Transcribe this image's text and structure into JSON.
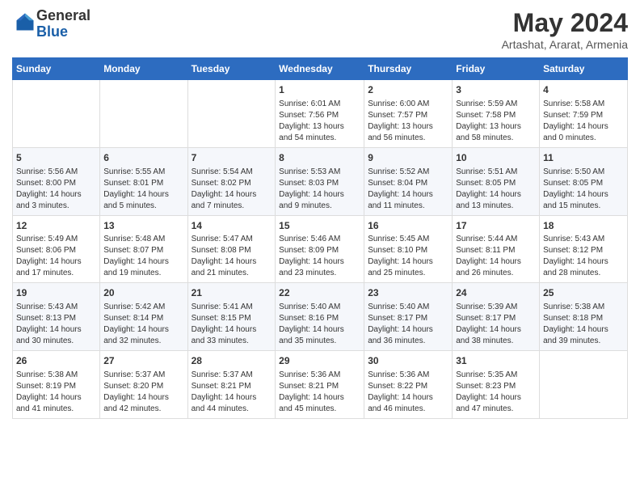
{
  "header": {
    "logo_general": "General",
    "logo_blue": "Blue",
    "month_title": "May 2024",
    "subtitle": "Artashat, Ararat, Armenia"
  },
  "days_of_week": [
    "Sunday",
    "Monday",
    "Tuesday",
    "Wednesday",
    "Thursday",
    "Friday",
    "Saturday"
  ],
  "weeks": [
    [
      {
        "num": "",
        "info": ""
      },
      {
        "num": "",
        "info": ""
      },
      {
        "num": "",
        "info": ""
      },
      {
        "num": "1",
        "info": "Sunrise: 6:01 AM\nSunset: 7:56 PM\nDaylight: 13 hours\nand 54 minutes."
      },
      {
        "num": "2",
        "info": "Sunrise: 6:00 AM\nSunset: 7:57 PM\nDaylight: 13 hours\nand 56 minutes."
      },
      {
        "num": "3",
        "info": "Sunrise: 5:59 AM\nSunset: 7:58 PM\nDaylight: 13 hours\nand 58 minutes."
      },
      {
        "num": "4",
        "info": "Sunrise: 5:58 AM\nSunset: 7:59 PM\nDaylight: 14 hours\nand 0 minutes."
      }
    ],
    [
      {
        "num": "5",
        "info": "Sunrise: 5:56 AM\nSunset: 8:00 PM\nDaylight: 14 hours\nand 3 minutes."
      },
      {
        "num": "6",
        "info": "Sunrise: 5:55 AM\nSunset: 8:01 PM\nDaylight: 14 hours\nand 5 minutes."
      },
      {
        "num": "7",
        "info": "Sunrise: 5:54 AM\nSunset: 8:02 PM\nDaylight: 14 hours\nand 7 minutes."
      },
      {
        "num": "8",
        "info": "Sunrise: 5:53 AM\nSunset: 8:03 PM\nDaylight: 14 hours\nand 9 minutes."
      },
      {
        "num": "9",
        "info": "Sunrise: 5:52 AM\nSunset: 8:04 PM\nDaylight: 14 hours\nand 11 minutes."
      },
      {
        "num": "10",
        "info": "Sunrise: 5:51 AM\nSunset: 8:05 PM\nDaylight: 14 hours\nand 13 minutes."
      },
      {
        "num": "11",
        "info": "Sunrise: 5:50 AM\nSunset: 8:05 PM\nDaylight: 14 hours\nand 15 minutes."
      }
    ],
    [
      {
        "num": "12",
        "info": "Sunrise: 5:49 AM\nSunset: 8:06 PM\nDaylight: 14 hours\nand 17 minutes."
      },
      {
        "num": "13",
        "info": "Sunrise: 5:48 AM\nSunset: 8:07 PM\nDaylight: 14 hours\nand 19 minutes."
      },
      {
        "num": "14",
        "info": "Sunrise: 5:47 AM\nSunset: 8:08 PM\nDaylight: 14 hours\nand 21 minutes."
      },
      {
        "num": "15",
        "info": "Sunrise: 5:46 AM\nSunset: 8:09 PM\nDaylight: 14 hours\nand 23 minutes."
      },
      {
        "num": "16",
        "info": "Sunrise: 5:45 AM\nSunset: 8:10 PM\nDaylight: 14 hours\nand 25 minutes."
      },
      {
        "num": "17",
        "info": "Sunrise: 5:44 AM\nSunset: 8:11 PM\nDaylight: 14 hours\nand 26 minutes."
      },
      {
        "num": "18",
        "info": "Sunrise: 5:43 AM\nSunset: 8:12 PM\nDaylight: 14 hours\nand 28 minutes."
      }
    ],
    [
      {
        "num": "19",
        "info": "Sunrise: 5:43 AM\nSunset: 8:13 PM\nDaylight: 14 hours\nand 30 minutes."
      },
      {
        "num": "20",
        "info": "Sunrise: 5:42 AM\nSunset: 8:14 PM\nDaylight: 14 hours\nand 32 minutes."
      },
      {
        "num": "21",
        "info": "Sunrise: 5:41 AM\nSunset: 8:15 PM\nDaylight: 14 hours\nand 33 minutes."
      },
      {
        "num": "22",
        "info": "Sunrise: 5:40 AM\nSunset: 8:16 PM\nDaylight: 14 hours\nand 35 minutes."
      },
      {
        "num": "23",
        "info": "Sunrise: 5:40 AM\nSunset: 8:17 PM\nDaylight: 14 hours\nand 36 minutes."
      },
      {
        "num": "24",
        "info": "Sunrise: 5:39 AM\nSunset: 8:17 PM\nDaylight: 14 hours\nand 38 minutes."
      },
      {
        "num": "25",
        "info": "Sunrise: 5:38 AM\nSunset: 8:18 PM\nDaylight: 14 hours\nand 39 minutes."
      }
    ],
    [
      {
        "num": "26",
        "info": "Sunrise: 5:38 AM\nSunset: 8:19 PM\nDaylight: 14 hours\nand 41 minutes."
      },
      {
        "num": "27",
        "info": "Sunrise: 5:37 AM\nSunset: 8:20 PM\nDaylight: 14 hours\nand 42 minutes."
      },
      {
        "num": "28",
        "info": "Sunrise: 5:37 AM\nSunset: 8:21 PM\nDaylight: 14 hours\nand 44 minutes."
      },
      {
        "num": "29",
        "info": "Sunrise: 5:36 AM\nSunset: 8:21 PM\nDaylight: 14 hours\nand 45 minutes."
      },
      {
        "num": "30",
        "info": "Sunrise: 5:36 AM\nSunset: 8:22 PM\nDaylight: 14 hours\nand 46 minutes."
      },
      {
        "num": "31",
        "info": "Sunrise: 5:35 AM\nSunset: 8:23 PM\nDaylight: 14 hours\nand 47 minutes."
      },
      {
        "num": "",
        "info": ""
      }
    ]
  ]
}
